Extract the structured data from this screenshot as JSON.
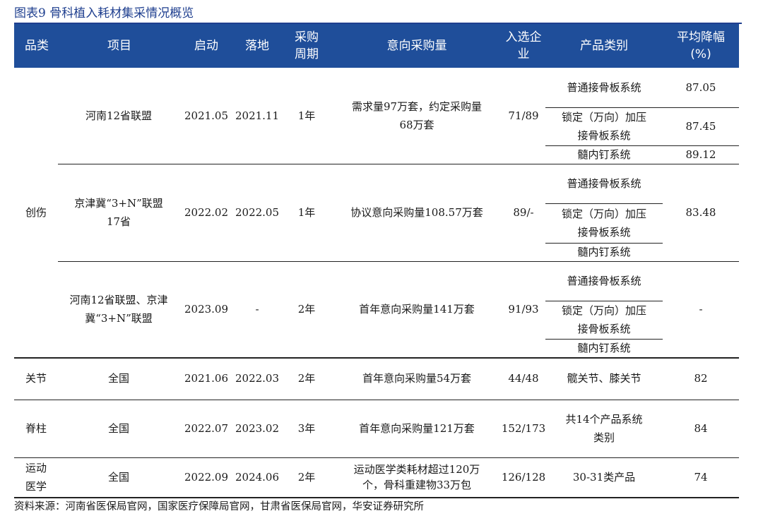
{
  "title": "图表9 骨科植入耗材集采情况概览",
  "headers": {
    "category": "品类",
    "project": "项目",
    "start": "启动",
    "land": "落地",
    "cycle": "采购\n周期",
    "volume": "意向采购量",
    "selected": "入选企\n业",
    "product": "产品类别",
    "drop": "平均降幅\n(%)"
  },
  "rows": {
    "trauma_label": "创伤",
    "r1": {
      "project": "河南12省联盟",
      "start": "2021.05",
      "land": "2021.11",
      "cycle": "1年",
      "volume": "需求量97万套，约定采购量\n68万套",
      "selected": "71/89",
      "products": [
        "普通接骨板系统",
        "锁定（万向）加压\n接骨板系统",
        "髓内钉系统"
      ],
      "drops": [
        "87.05",
        "87.45",
        "89.12"
      ]
    },
    "r2": {
      "project": "京津冀“3+N”联盟\n17省",
      "start": "2022.02",
      "land": "2022.05",
      "cycle": "1年",
      "volume": "协议意向采购量108.57万套",
      "selected": "89/-",
      "products": [
        "普通接骨板系统",
        "锁定（万向）加压\n接骨板系统",
        "髓内钉系统"
      ],
      "drop": "83.48"
    },
    "r3": {
      "project": "河南12省联盟、京津\n冀“3+N”联盟",
      "start": "2023.09",
      "land": "-",
      "cycle": "2年",
      "volume": "首年意向采购量141万套",
      "selected": "91/93",
      "products": [
        "普通接骨板系统",
        "锁定（万向）加压\n接骨板系统",
        "髓内钉系统"
      ],
      "drop": "-"
    },
    "r4": {
      "category": "关节",
      "project": "全国",
      "start": "2021.06",
      "land": "2022.03",
      "cycle": "2年",
      "volume": "首年意向采购量54万套",
      "selected": "44/48",
      "product": "髋关节、膝关节",
      "drop": "82"
    },
    "r5": {
      "category": "脊柱",
      "project": "全国",
      "start": "2022.07",
      "land": "2023.02",
      "cycle": "3年",
      "volume": "首年意向采购量121万套",
      "selected": "152/173",
      "product": "共14个产品系统\n类别",
      "drop": "84"
    },
    "r6": {
      "category": "运动\n医学",
      "project": "全国",
      "start": "2022.09",
      "land": "2024.06",
      "cycle": "2年",
      "volume": "运动医学类耗材超过120万\n个，骨科重建物33万包",
      "selected": "126/128",
      "product": "30-31类产品",
      "drop": "74"
    }
  },
  "footer": "资料来源：河南省医保局官网，国家医疗保障局官网，甘肃省医保局官网，华安证券研究所"
}
